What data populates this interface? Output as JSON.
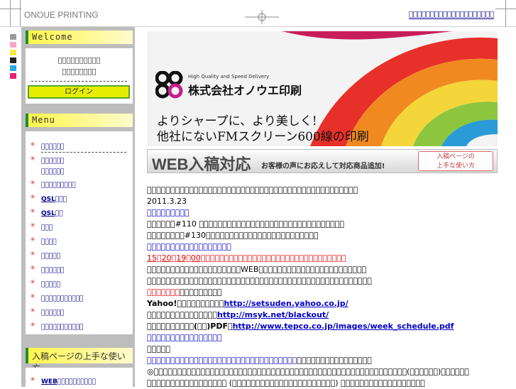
{
  "header": {
    "site_title": "ONOUE PRINTING",
    "top_links": "\u0000\u0000\u0000\u0000\u0000\u0000\u0000\u0000\u0000\u0000\u0000\u0000\u0000\u0000\u0000\u0000\u0000\u0000\u0000\u0000"
  },
  "sidebar": {
    "welcome_title": "Welcome",
    "welcome_line1": "\u0000\u0000\u0000\u0000\u0000\u0000\u0000\u0000\u0000\u0000",
    "welcome_line2": "\u0000\u0000\u0000\u0000\u0000\u0000\u0000\u0000",
    "login_label": "ログイン",
    "menu_title": "Menu",
    "menu_items": [
      {
        "label": "\u0000\u0000\u0000\u0000\u0000\u0000"
      },
      {
        "label": "\u0000\u0000\u0000\u0000\u0000\u0000"
      },
      {
        "label": "\u0000\u0000\u0000\u0000\u0000\u0000\u0000\u0000\u0000"
      },
      {
        "label": "QSL\u0000\u0000\u0000"
      },
      {
        "label": "QSL\u0000\u0000"
      },
      {
        "label": "\u0000\u0000\u0000"
      },
      {
        "label": "\u0000\u0000\u0000\u0000"
      },
      {
        "label": "\u0000\u0000\u0000\u0000\u0000"
      },
      {
        "label": "\u0000\u0000\u0000\u0000\u0000\u0000"
      },
      {
        "label": "\u0000\u0000\u0000\u0000\u0000"
      },
      {
        "label": "\u0000\u0000\u0000\u0000\u0000\u0000\u0000\u0000\u0000\u0000\u0000"
      },
      {
        "label": "\u0000\u0000\u0000\u0000\u0000\u0000"
      },
      {
        "label": "\u0000\u0000\u0000\u0000\u0000\u0000\u0000\u0000\u0000\u0000\u0000"
      }
    ],
    "menu_item1_line2": "\u0000\u0000\u0000\u0000\u0000\u0000",
    "guide_title": "入稿ページの上手な使い方",
    "guide_item": "WEB\u0000\u0000\u0000\u0000\u0000\u0000\u0000\u0000\u0000\u0000"
  },
  "banner": {
    "tagline": "High Quality and Speed Delivery",
    "brand": "株式会社オノウエ印刷",
    "copy1": "よりシャープに、より美しく!",
    "copy2": "他社にないFMスクリーン600線の印刷"
  },
  "web_banner": {
    "title": "WEB入稿対応",
    "subtitle": "お客様の声にお応えして対応商品追加!",
    "button_line1": "入稿ページの",
    "button_line2": "上手な使い方"
  },
  "content": {
    "line1": "\u0000\u0000\u0000\u0000\u0000\u0000\u0000\u0000\u0000\u0000\u0000\u0000\u0000\u0000\u0000\u0000\u0000\u0000\u0000\u0000\u0000\u0000\u0000\u0000\u0000\u0000\u0000\u0000\u0000\u0000\u0000\u0000\u0000\u0000\u0000\u0000\u0000\u0000\u0000\u0000\u0000\u0000\u0000\u0000\u0000",
    "date": "2011.3.23",
    "link1": "\u0000\u0000\u0000\u0000\u0000\u0000\u0000\u0000\u0000",
    "line_110": "\u0000\u0000\u0000\u0000\u0000\u0000#110 \u0000\u0000\u0000\u0000\u0000\u0000\u0000\u0000\u0000\u0000\u0000\u0000\u0000\u0000\u0000\u0000\u0000\u0000\u0000\u0000\u0000\u0000\u0000\u0000\u0000\u0000\u0000\u0000\u0000\u0000\u0000",
    "line_130": "\u0000\u0000\u0000\u0000\u0000\u0000\u0000\u0000#130\u0000\u0000\u0000\u0000\u0000\u0000\u0000\u0000\u0000\u0000\u0000\u0000\u0000\u0000\u0000\u0000\u0000\u0000\u0000\u0000\u0000\u0000\u0000\u0000",
    "link2": "\u0000\u0000\u0000\u0000\u0000\u0000\u0000\u0000\u0000\u0000\u0000\u0000\u0000\u0000\u0000\u0000\u0000\u0000",
    "red_line": "15\u000020\u000019\u000000\u0000\u0000\u0000\u0000\u0000\u0000\u0000\u0000\u0000\u0000\u0000\u0000\u0000\u0000\u0000\u0000\u0000\u0000\u0000\u0000\u0000\u0000\u0000\u0000\u0000\u0000\u0000\u0000\u0000\u0000\u0000",
    "line_web": "\u0000\u0000\u0000\u0000\u0000\u0000\u0000\u0000\u0000\u0000\u0000\u0000\u0000\u0000\u0000\u0000\u0000\u0000\u0000\u0000WEB\u0000\u0000\u0000\u0000\u0000\u0000\u0000\u0000\u0000\u0000\u0000\u0000\u0000\u0000\u0000\u0000\u0000\u0000\u0000\u0000\u0000\u0000\u0000",
    "line_plain": "\u0000\u0000\u0000\u0000\u0000\u0000\u0000\u0000\u0000\u0000\u0000\u0000\u0000\u0000\u0000\u0000\u0000\u0000\u0000\u0000\u0000\u0000\u0000\u0000\u0000\u0000\u0000\u0000\u0000\u0000\u0000\u0000\u0000\u0000\u0000\u0000\u0000\u0000\u0000\u0000\u0000\u0000\u0000\u0000\u0000\u0000\u0000\u0000",
    "red_short": "\u0000\u0000\u0000\u0000\u0000\u0000\u0000",
    "after_red_short": "\u0000\u0000\u0000\u0000\u0000\u0000\u0000\u0000\u0000",
    "yahoo_prefix": "Yahoo!\u0000\u0000\u0000\u0000\u0000\u0000\u0000\u0000\u0000\u0000",
    "yahoo_link": "http://setsuden.yahoo.co.jp/",
    "msyk_prefix": "\u0000\u0000\u0000\u0000\u0000\u0000\u0000\u0000\u0000\u0000\u0000\u0000\u0000\u0000\u0000",
    "msyk_link": "http://msyk.net/blackout/",
    "tepco_prefix": "\u0000\u0000\u0000\u0000\u0000\u0000\u0000\u0000\u0000\u0000(\u0000\u0000)PDF\u0000",
    "tepco_link": "http://www.tepco.co.jp/images/week_schedule.pdf",
    "link3": "\u0000\u0000\u0000\u0000\u0000\u0000\u0000\u0000\u0000\u0000\u0000\u0000\u0000\u0000\u0000\u0000",
    "bold_short": "\u0000\u0000\u0000\u0000\u0000",
    "link4": "\u0000\u0000\u0000\u0000\u0000\u0000\u0000\u0000\u0000\u0000\u0000\u0000\u0000\u0000\u0000\u0000\u0000\u0000\u0000\u0000\u0000\u0000\u0000\u0000\u0000\u0000\u0000\u0000\u0000\u0000\u0000\u0000",
    "after_link4": "\u0000\u0000\u0000\u0000\u0000\u0000\u0000\u0000\u0000\u0000\u0000\u0000\u0000\u0000\u0000\u0000",
    "para": "◎\u0000\u0000\u0000\u0000\u0000\u0000\u0000\u0000\u0000\u0000\u0000\u0000\u0000\u0000\u0000\u0000\u0000\u0000\u0000\u0000\u0000\u0000\u0000\u0000\u0000\u0000\u0000\u0000\u0000\u0000\u0000\u0000\u0000\u0000\u0000\u0000\u0000\u0000\u0000\u0000\u0000\u0000\u0000\u0000\u0000\u0000\u0000\u0000\u0000\u0000\u0000\u0000\u0000\u0000(\u0000\u0000\u0000\u0000\u0000\u0000)\u0000\u0000\u0000\u0000\u0000\u0000 \u0000\u0000\u0000\u0000\u0000\u0000\u0000\u0000\u0000\u0000\u0000\u0000\u0000\u0000\u0000\u0000\u0000 (\u0000\u0000\u0000\u0000\u0000\u0000\u0000\u0000\u0000\u0000\u0000\u0000\u0000\u0000\u0000\u0000\u0000\u0000\u0000\u0000\u0000\u0000) \u0000\u0000\u0000\u0000\u0000\u0000\u0000\u0000\u0000\u0000\u0000\u0000\u0000\u0000\u0000\u0000\u0000\u0000"
  },
  "colors": {
    "sidebar_bg": "#bdbdbd",
    "heading_yellow": "#fff64a",
    "heading_green": "#1a8f32",
    "link_blue": "#0000cc",
    "alert_red": "#e00000",
    "login_yellow": "#e6ee00"
  }
}
